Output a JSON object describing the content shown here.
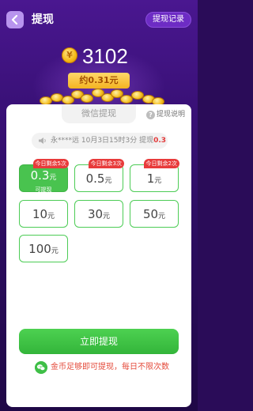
{
  "header": {
    "title": "提现",
    "record_label": "提现记录"
  },
  "balance": {
    "coins": "3102",
    "coin_symbol": "¥",
    "approx": "约0.31元"
  },
  "tabs": {
    "wechat_label": "微信提现",
    "help_label": "提现说明",
    "help_symbol": "?"
  },
  "notice": {
    "text": "永****远 10月3日15时3分 提现",
    "amount": "0.3"
  },
  "options": [
    {
      "amount": "0.3",
      "unit": "元",
      "sub": "可提现",
      "badge": "今日剩余5次",
      "selected": true
    },
    {
      "amount": "0.5",
      "unit": "元",
      "badge": "今日剩余3次",
      "selected": false
    },
    {
      "amount": "1",
      "unit": "元",
      "badge": "今日剩余2次",
      "selected": false
    },
    {
      "amount": "10",
      "unit": "元",
      "selected": false
    },
    {
      "amount": "30",
      "unit": "元",
      "selected": false
    },
    {
      "amount": "50",
      "unit": "元",
      "selected": false
    },
    {
      "amount": "100",
      "unit": "元",
      "selected": false
    }
  ],
  "actions": {
    "withdraw_label": "立即提现"
  },
  "tip": {
    "text": "金币足够即可提现，每日不限次数"
  },
  "colors": {
    "accent_green": "#49c34f",
    "badge_red": "#e83b3b",
    "background_purple": "#3a1178"
  }
}
